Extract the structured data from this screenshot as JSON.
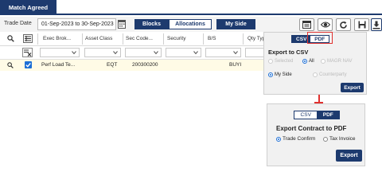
{
  "tabs": {
    "active_label": "Match Agreed"
  },
  "toolbar": {
    "trade_date_label": "Trade Date",
    "trade_date_value": "01-Sep-2023 to 30-Sep-2023",
    "blocks_label": "Blocks",
    "allocations_label": "Allocations",
    "my_side_label": "My Side"
  },
  "grid": {
    "columns": [
      "Exec Brok...",
      "Asset Class",
      "Sec Code...",
      "Security",
      "B/S",
      "Qty Typ"
    ],
    "rows": [
      {
        "exec_broker": "Perf Load Te...",
        "asset_class": "EQT",
        "sec_code": "200300200",
        "security": "",
        "bs": "BUYI"
      }
    ]
  },
  "csv_popup": {
    "toggle_csv": "CSV",
    "toggle_pdf": "PDF",
    "title": "Export to CSV",
    "options": [
      "Selected",
      "All",
      "MAGR NAV"
    ],
    "my_side": "My Side",
    "counterparty": "Counterparty",
    "export_label": "Export"
  },
  "pdf_popup": {
    "toggle_csv": "CSV",
    "toggle_pdf": "PDF",
    "title": "Export Contract to PDF",
    "trade_confirm": "Trade Confirm",
    "tax_invoice": "Tax Invoice",
    "export_label": "Export"
  },
  "colors": {
    "primary": "#1d3a6e",
    "highlight": "#e0312f",
    "row_highlight": "#fffbe6"
  }
}
